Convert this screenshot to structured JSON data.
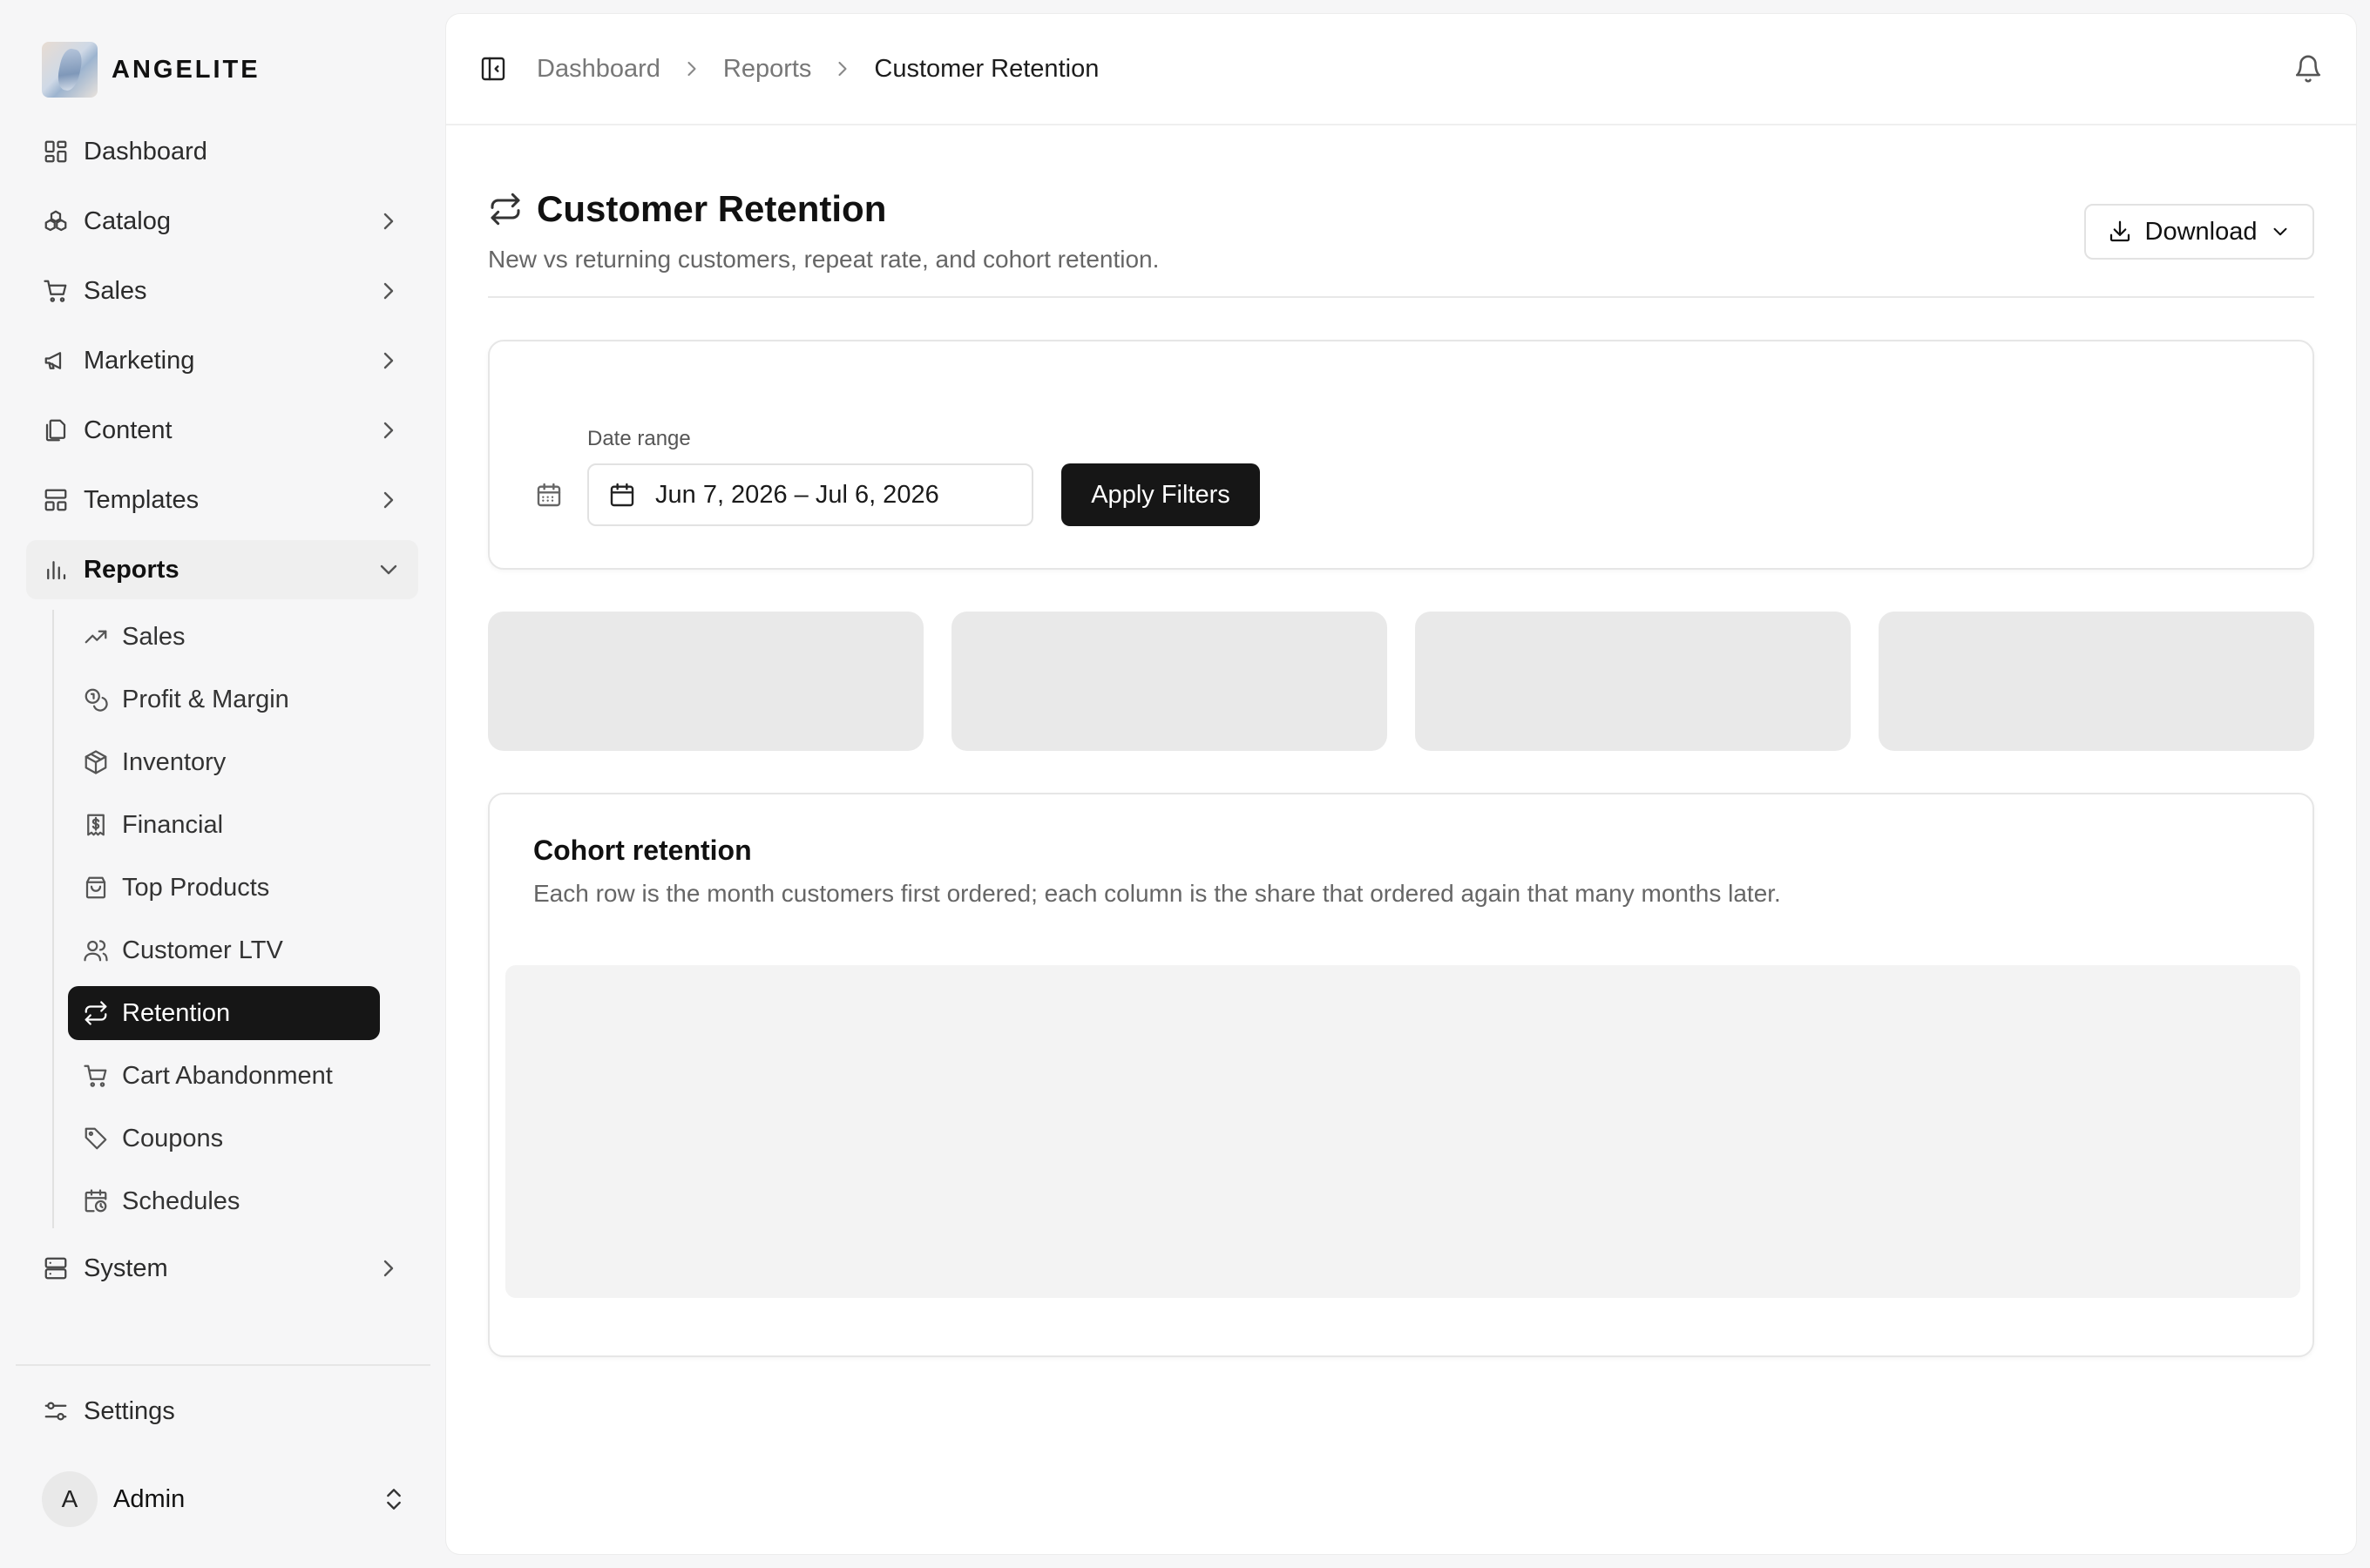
{
  "brand": {
    "name": "ANGELITE"
  },
  "sidebar": {
    "items": [
      {
        "label": "Dashboard",
        "icon": "dashboard-icon",
        "chevron": false
      },
      {
        "label": "Catalog",
        "icon": "catalog-icon",
        "chevron": true
      },
      {
        "label": "Sales",
        "icon": "cart-icon",
        "chevron": true
      },
      {
        "label": "Marketing",
        "icon": "megaphone-icon",
        "chevron": true
      },
      {
        "label": "Content",
        "icon": "files-icon",
        "chevron": true
      },
      {
        "label": "Templates",
        "icon": "layout-icon",
        "chevron": true
      },
      {
        "label": "Reports",
        "icon": "bar-chart-icon",
        "chevron": "down",
        "expanded": true
      }
    ],
    "reports_sub": [
      {
        "label": "Sales",
        "icon": "trending-up-icon"
      },
      {
        "label": "Profit & Margin",
        "icon": "coins-icon"
      },
      {
        "label": "Inventory",
        "icon": "package-icon"
      },
      {
        "label": "Financial",
        "icon": "receipt-dollar-icon"
      },
      {
        "label": "Top Products",
        "icon": "shopping-bag-icon"
      },
      {
        "label": "Customer LTV",
        "icon": "users-icon"
      },
      {
        "label": "Retention",
        "icon": "repeat-icon",
        "active": true
      },
      {
        "label": "Cart Abandonment",
        "icon": "cart-icon"
      },
      {
        "label": "Coupons",
        "icon": "tag-icon"
      },
      {
        "label": "Schedules",
        "icon": "calendar-clock-icon"
      }
    ],
    "system": {
      "label": "System",
      "icon": "server-icon"
    },
    "settings": {
      "label": "Settings",
      "icon": "sliders-icon"
    },
    "user": {
      "initial": "A",
      "name": "Admin"
    }
  },
  "breadcrumb": [
    "Dashboard",
    "Reports",
    "Customer Retention"
  ],
  "page": {
    "title": "Customer Retention",
    "subtitle": "New vs returning customers, repeat rate, and cohort retention.",
    "download_label": "Download"
  },
  "filters": {
    "date_label": "Date range",
    "date_value": "Jun 7, 2026 – Jul 6, 2026",
    "apply_label": "Apply Filters"
  },
  "cohort": {
    "title": "Cohort retention",
    "subtitle": "Each row is the month customers first ordered; each column is the share that ordered again that many months later."
  },
  "colors": {
    "active_bg": "#161616",
    "skeleton": "#e9e9e9",
    "page_bg": "#f6f6f7"
  }
}
